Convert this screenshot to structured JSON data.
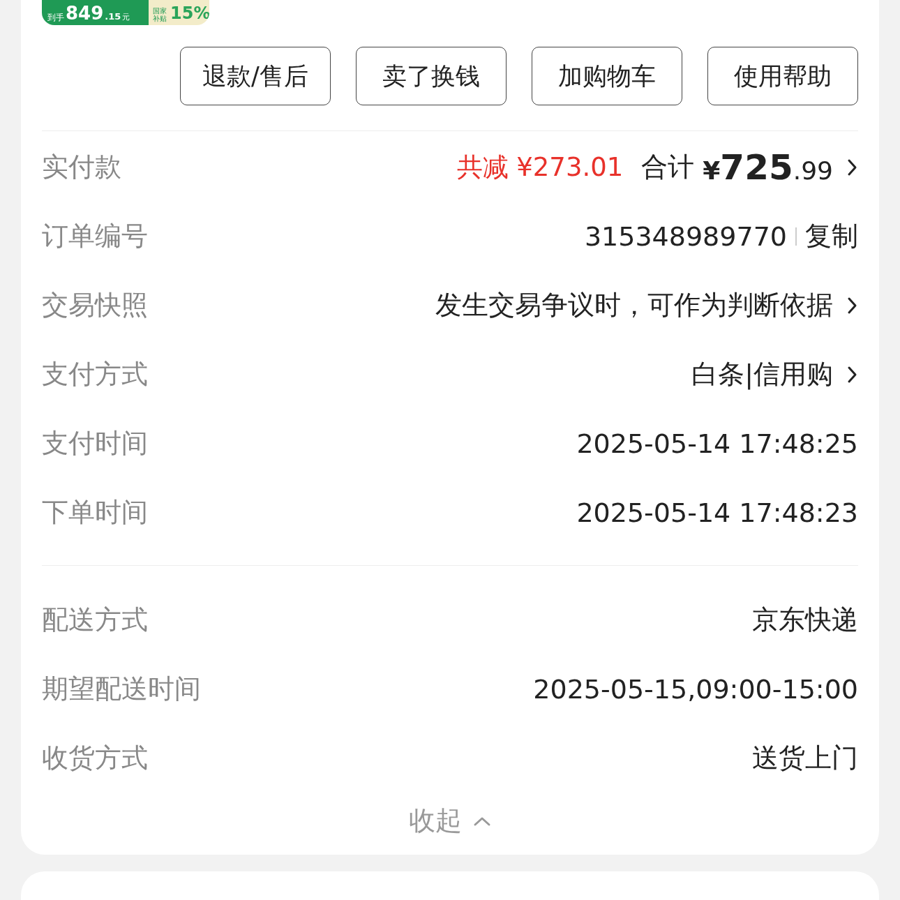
{
  "banner": {
    "prefix": "到手",
    "amount": "849",
    "decimal": ".15",
    "unit": "元",
    "subsidy_label": "国家补贴",
    "subsidy_rate": "15%"
  },
  "buttons": [
    "退款/售后",
    "卖了换钱",
    "加购物车",
    "使用帮助"
  ],
  "sections": [
    {
      "rows": [
        {
          "kind": "price",
          "label": "实付款",
          "discount": "共减 ¥273.01",
          "total_label": "合计",
          "currency": "¥",
          "total_int": "725",
          "total_dec": ".99",
          "chevron": true
        },
        {
          "kind": "copy",
          "label": "订单编号",
          "value": "315348989770",
          "action": "复制",
          "chevron": false
        },
        {
          "kind": "plain",
          "label": "交易快照",
          "value": "发生交易争议时，可作为判断依据",
          "chevron": true
        },
        {
          "kind": "plain",
          "label": "支付方式",
          "value": "白条|信用购",
          "chevron": true
        },
        {
          "kind": "plain",
          "label": "支付时间",
          "value": "2025-05-14 17:48:25",
          "chevron": false
        },
        {
          "kind": "plain",
          "label": "下单时间",
          "value": "2025-05-14 17:48:23",
          "chevron": false
        }
      ]
    },
    {
      "rows": [
        {
          "kind": "plain",
          "label": "配送方式",
          "value": "京东快递",
          "chevron": false
        },
        {
          "kind": "plain",
          "label": "期望配送时间",
          "value": "2025-05-15,09:00-15:00",
          "chevron": false
        },
        {
          "kind": "plain",
          "label": "收货方式",
          "value": "送货上门",
          "chevron": false
        }
      ]
    }
  ],
  "collapse": {
    "label": "收起",
    "expanded": true
  }
}
